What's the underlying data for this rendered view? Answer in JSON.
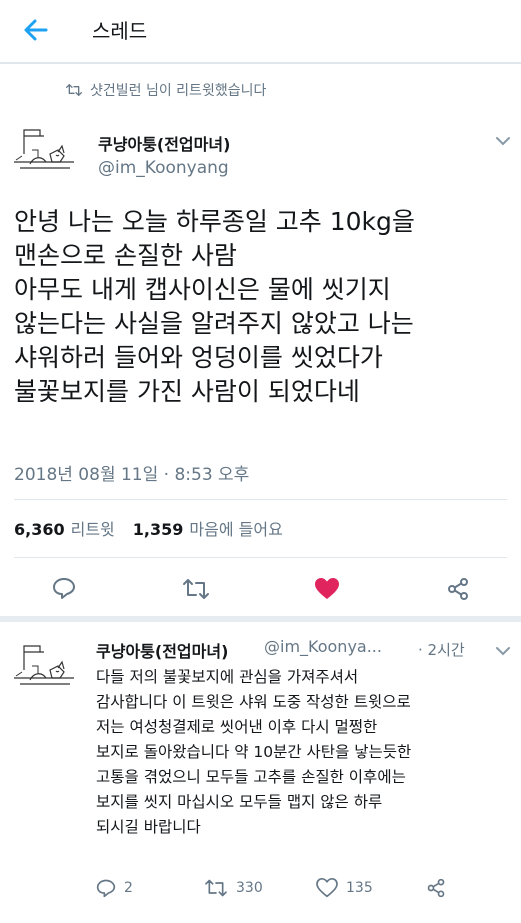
{
  "header": {
    "title": "스레드"
  },
  "retweet_banner": {
    "text": "샷건빌런 님이 리트윗했습니다"
  },
  "main_tweet": {
    "author_name": "쿠냥아퉁(전업마녀)",
    "author_handle": "@im_Koonyang",
    "text": "안녕 나는 오늘 하루종일 고추 10kg을\n맨손으로 손질한 사람\n아무도 내게 캡사이신은 물에 씻기지\n않는다는 사실을 알려주지 않았고 나는\n샤워하러 들어와 엉덩이를 씻었다가\n불꽃보지를 가진 사람이 되었다네",
    "timestamp": "2018년 08월 11일 · 8:53 오후",
    "retweets": {
      "count": "6,360",
      "label": "리트윗"
    },
    "likes": {
      "count": "1,359",
      "label": "마음에 들어요"
    },
    "liked": true
  },
  "reply_tweet": {
    "author_name": "쿠냥아퉁(전업마녀)",
    "author_handle": "@im_Koonya...",
    "time": "· 2시간",
    "text": "다들 저의 불꽃보지에 관심을 가져주셔서\n감사합니다 이 트윗은 샤워 도중 작성한 트윗으로\n저는 여성청결제로 씻어낸 이후 다시 멀쩡한\n보지로 돌아왔습니다 약 10분간 사탄을 낳는듯한\n고통을 겪었으니 모두들 고추를 손질한 이후에는\n보지를 씻지 마십시오 모두들 맵지 않은 하루\n되시길 바랍니다",
    "replies": "2",
    "retweets": "330",
    "likes": "135"
  },
  "icons": {
    "back": "arrow-left-icon",
    "retweet": "retweet-icon",
    "reply": "reply-icon",
    "like": "heart-icon",
    "share": "share-icon",
    "caret": "chevron-down-icon"
  },
  "colors": {
    "accent": "#1da1f2",
    "like": "#e0245e",
    "secondary_text": "#657786",
    "divider": "#e1e8ed"
  }
}
